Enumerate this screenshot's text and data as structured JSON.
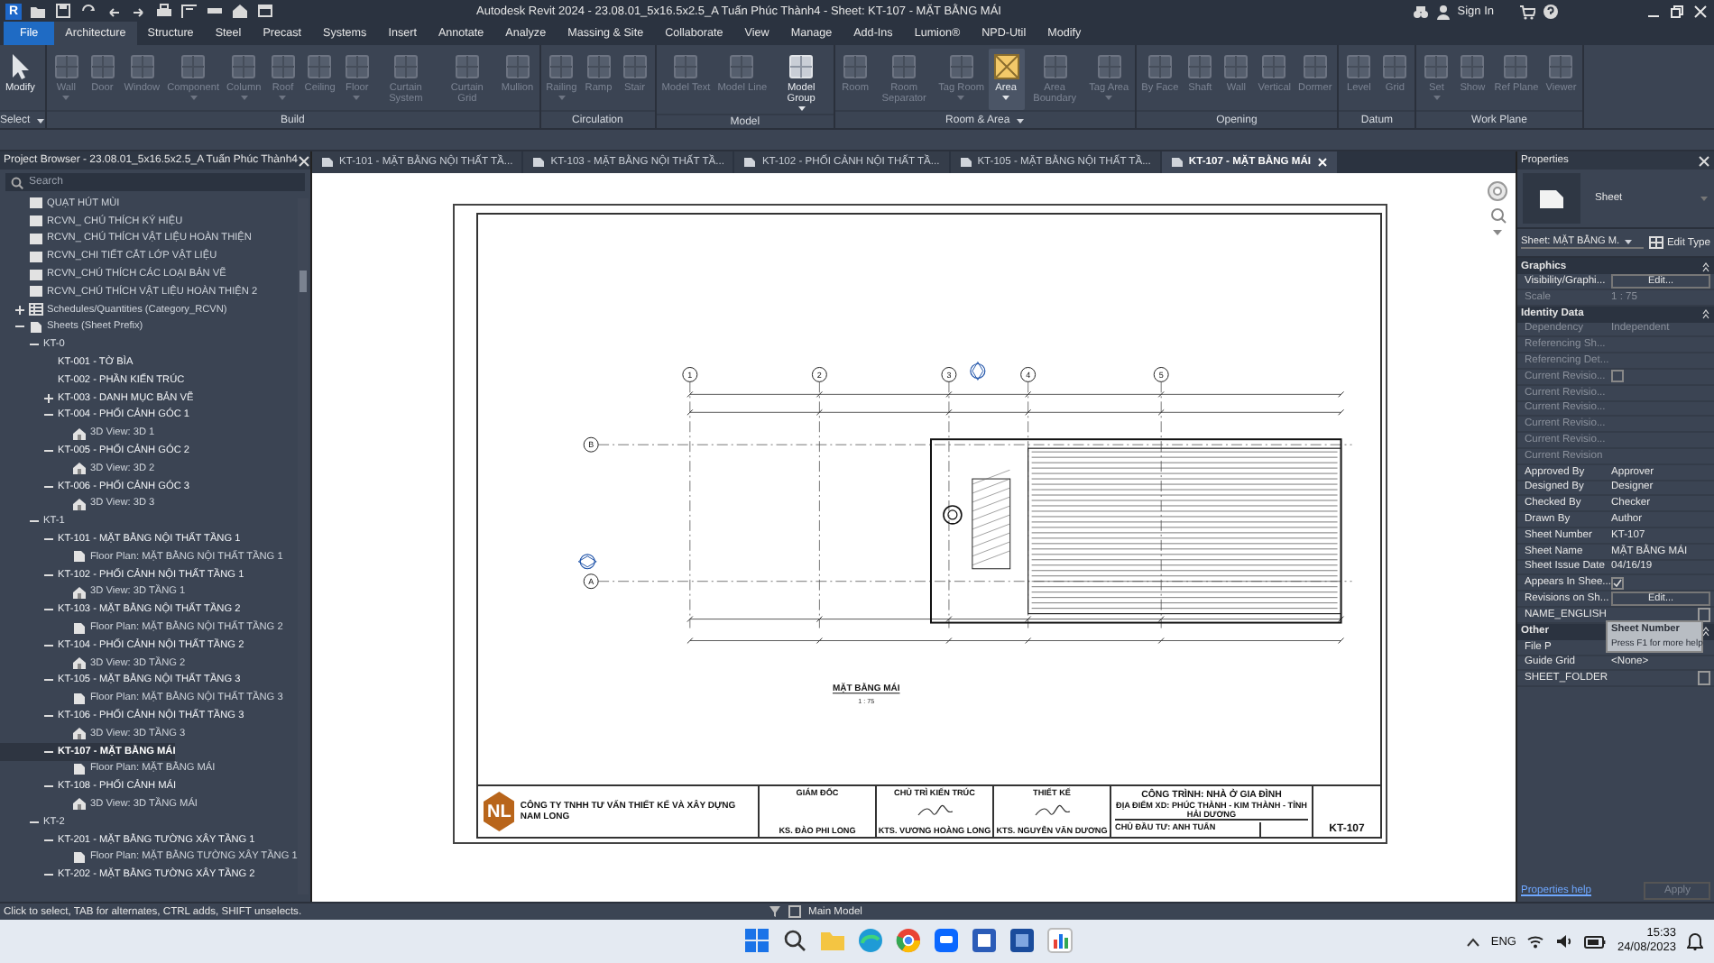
{
  "window": {
    "app_logo": "R",
    "title": "Autodesk Revit 2024 - 23.08.01_5x16.5x2.5_A Tuấn Phúc Thành4 - Sheet: KT-107 - MẶT BẰNG MÁI",
    "sign_in": "Sign In"
  },
  "ribbon_tabs": [
    {
      "label": "File",
      "kind": "file",
      "selected": false
    },
    {
      "label": "Architecture",
      "kind": "tab",
      "selected": true
    },
    {
      "label": "Structure",
      "kind": "tab",
      "selected": false
    },
    {
      "label": "Steel",
      "kind": "tab",
      "selected": false
    },
    {
      "label": "Precast",
      "kind": "tab",
      "selected": false
    },
    {
      "label": "Systems",
      "kind": "tab",
      "selected": false
    },
    {
      "label": "Insert",
      "kind": "tab",
      "selected": false
    },
    {
      "label": "Annotate",
      "kind": "tab",
      "selected": false
    },
    {
      "label": "Analyze",
      "kind": "tab",
      "selected": false
    },
    {
      "label": "Massing & Site",
      "kind": "tab",
      "selected": false
    },
    {
      "label": "Collaborate",
      "kind": "tab",
      "selected": false
    },
    {
      "label": "View",
      "kind": "tab",
      "selected": false
    },
    {
      "label": "Manage",
      "kind": "tab",
      "selected": false
    },
    {
      "label": "Add-Ins",
      "kind": "tab",
      "selected": false
    },
    {
      "label": "Lumion®",
      "kind": "tab",
      "selected": false
    },
    {
      "label": "NPD-Util",
      "kind": "tab",
      "selected": false
    },
    {
      "label": "Modify",
      "kind": "tab",
      "selected": false
    }
  ],
  "ribbon_panels": [
    {
      "title": "Select",
      "has_menu": true,
      "tools": [
        {
          "label": "Modify",
          "disabled": false,
          "selected": false,
          "dropdown": false
        }
      ]
    },
    {
      "title": "Build",
      "has_menu": false,
      "tools": [
        {
          "label": "Wall",
          "disabled": true,
          "selected": false,
          "dropdown": true
        },
        {
          "label": "Door",
          "disabled": true,
          "selected": false,
          "dropdown": false
        },
        {
          "label": "Window",
          "disabled": true,
          "selected": false,
          "dropdown": false
        },
        {
          "label": "Component",
          "disabled": true,
          "selected": false,
          "dropdown": true
        },
        {
          "label": "Column",
          "disabled": true,
          "selected": false,
          "dropdown": true
        },
        {
          "label": "Roof",
          "disabled": true,
          "selected": false,
          "dropdown": true
        },
        {
          "label": "Ceiling",
          "disabled": true,
          "selected": false,
          "dropdown": false
        },
        {
          "label": "Floor",
          "disabled": true,
          "selected": false,
          "dropdown": true
        },
        {
          "label": "Curtain System",
          "disabled": true,
          "selected": false,
          "dropdown": false
        },
        {
          "label": "Curtain Grid",
          "disabled": true,
          "selected": false,
          "dropdown": false
        },
        {
          "label": "Mullion",
          "disabled": true,
          "selected": false,
          "dropdown": false
        }
      ]
    },
    {
      "title": "Circulation",
      "has_menu": false,
      "tools": [
        {
          "label": "Railing",
          "disabled": true,
          "selected": false,
          "dropdown": true
        },
        {
          "label": "Ramp",
          "disabled": true,
          "selected": false,
          "dropdown": false
        },
        {
          "label": "Stair",
          "disabled": true,
          "selected": false,
          "dropdown": false
        }
      ]
    },
    {
      "title": "Model",
      "has_menu": false,
      "tools": [
        {
          "label": "Model Text",
          "disabled": true,
          "selected": false,
          "dropdown": false
        },
        {
          "label": "Model Line",
          "disabled": true,
          "selected": false,
          "dropdown": false
        },
        {
          "label": "Model Group",
          "disabled": false,
          "selected": false,
          "dropdown": true
        }
      ]
    },
    {
      "title": "Room & Area",
      "has_menu": true,
      "tools": [
        {
          "label": "Room",
          "disabled": true,
          "selected": false,
          "dropdown": false
        },
        {
          "label": "Room Separator",
          "disabled": true,
          "selected": false,
          "dropdown": false
        },
        {
          "label": "Tag Room",
          "disabled": true,
          "selected": false,
          "dropdown": true
        },
        {
          "label": "Area",
          "disabled": false,
          "selected": true,
          "dropdown": true
        },
        {
          "label": "Area Boundary",
          "disabled": true,
          "selected": false,
          "dropdown": false
        },
        {
          "label": "Tag Area",
          "disabled": true,
          "selected": false,
          "dropdown": true
        }
      ]
    },
    {
      "title": "Opening",
      "has_menu": false,
      "tools": [
        {
          "label": "By Face",
          "disabled": true,
          "selected": false,
          "dropdown": false
        },
        {
          "label": "Shaft",
          "disabled": true,
          "selected": false,
          "dropdown": false
        },
        {
          "label": "Wall",
          "disabled": true,
          "selected": false,
          "dropdown": false
        },
        {
          "label": "Vertical",
          "disabled": true,
          "selected": false,
          "dropdown": false
        },
        {
          "label": "Dormer",
          "disabled": true,
          "selected": false,
          "dropdown": false
        }
      ]
    },
    {
      "title": "Datum",
      "has_menu": false,
      "tools": [
        {
          "label": "Level",
          "disabled": true,
          "selected": false,
          "dropdown": false
        },
        {
          "label": "Grid",
          "disabled": true,
          "selected": false,
          "dropdown": false
        }
      ]
    },
    {
      "title": "Work Plane",
      "has_menu": false,
      "tools": [
        {
          "label": "Set",
          "disabled": true,
          "selected": false,
          "dropdown": true
        },
        {
          "label": "Show",
          "disabled": true,
          "selected": false,
          "dropdown": false
        },
        {
          "label": "Ref Plane",
          "disabled": true,
          "selected": false,
          "dropdown": false
        },
        {
          "label": "Viewer",
          "disabled": true,
          "selected": false,
          "dropdown": false
        }
      ]
    }
  ],
  "project_browser": {
    "title": "Project Browser - 23.08.01_5x16.5x2.5_A Tuấn Phúc Thành4",
    "search": {
      "placeholder": "Search"
    },
    "tree": [
      {
        "label": "QUẠT HÚT MÙI",
        "kind": "legend",
        "selected": false
      },
      {
        "label": "RCVN_ CHÚ THÍCH KÝ HIỆU",
        "kind": "legend",
        "selected": false
      },
      {
        "label": "RCVN_ CHÚ THÍCH VẬT LIỆU HOÀN THIỆN",
        "kind": "legend",
        "selected": false
      },
      {
        "label": "RCVN_CHI TIẾT CẮT LỚP VẬT LIỆU",
        "kind": "legend",
        "selected": false
      },
      {
        "label": "RCVN_CHÚ THÍCH CÁC LOẠI BẢN VẼ",
        "kind": "legend",
        "selected": false
      },
      {
        "label": "RCVN_CHÚ THÍCH VẬT LIỆU HOÀN THIỆN 2",
        "kind": "legend",
        "selected": false
      },
      {
        "label": "Schedules/Quantities (Category_RCVN)",
        "kind": "schedules",
        "expanded": false,
        "selected": false
      },
      {
        "label": "Sheets (Sheet Prefix)",
        "kind": "sheets",
        "expanded": true,
        "selected": false,
        "children": [
          {
            "label": "KT-0",
            "kind": "group",
            "expanded": true,
            "selected": false,
            "children": [
              {
                "label": "KT-001 - TỜ BÌA",
                "kind": "sheet",
                "selected": false
              },
              {
                "label": "KT-002 - PHẦN KIẾN TRÚC",
                "kind": "sheet",
                "selected": false
              },
              {
                "label": "KT-003 - DANH MỤC BẢN VẼ",
                "kind": "sheet",
                "expanded": false,
                "selected": false
              },
              {
                "label": "KT-004 - PHỐI CẢNH GÓC 1",
                "kind": "sheet",
                "expanded": true,
                "selected": false,
                "children": [
                  {
                    "label": "3D View: 3D 1",
                    "kind": "view3d",
                    "selected": false
                  }
                ]
              },
              {
                "label": "KT-005 - PHỐI CẢNH GÓC 2",
                "kind": "sheet",
                "expanded": true,
                "selected": false,
                "children": [
                  {
                    "label": "3D View: 3D 2",
                    "kind": "view3d",
                    "selected": false
                  }
                ]
              },
              {
                "label": "KT-006 - PHỐI CẢNH GÓC 3",
                "kind": "sheet",
                "expanded": true,
                "selected": false,
                "children": [
                  {
                    "label": "3D View: 3D 3",
                    "kind": "view3d",
                    "selected": false
                  }
                ]
              }
            ]
          },
          {
            "label": "KT-1",
            "kind": "group",
            "expanded": true,
            "selected": false,
            "children": [
              {
                "label": "KT-101 - MẶT BẰNG NỘI THẤT TẦNG 1",
                "kind": "sheet",
                "expanded": true,
                "selected": false,
                "children": [
                  {
                    "label": "Floor Plan: MẶT BẰNG NỘI THẤT TẦNG 1",
                    "kind": "plan",
                    "selected": false
                  }
                ]
              },
              {
                "label": "KT-102 - PHỐI CẢNH NỘI THẤT TẦNG 1",
                "kind": "sheet",
                "expanded": true,
                "selected": false,
                "children": [
                  {
                    "label": "3D View: 3D TẦNG 1",
                    "kind": "view3d",
                    "selected": false
                  }
                ]
              },
              {
                "label": "KT-103 - MẶT BẰNG NỘI THẤT TẦNG 2",
                "kind": "sheet",
                "expanded": true,
                "selected": false,
                "children": [
                  {
                    "label": "Floor Plan: MẶT BẰNG NỘI THẤT TẦNG 2",
                    "kind": "plan",
                    "selected": false
                  }
                ]
              },
              {
                "label": "KT-104 - PHỐI CẢNH NỘI THẤT TẦNG 2",
                "kind": "sheet",
                "expanded": true,
                "selected": false,
                "children": [
                  {
                    "label": "3D View: 3D TẦNG 2",
                    "kind": "view3d",
                    "selected": false
                  }
                ]
              },
              {
                "label": "KT-105 - MẶT BẰNG NỘI THẤT TẦNG 3",
                "kind": "sheet",
                "expanded": true,
                "selected": false,
                "children": [
                  {
                    "label": "Floor Plan: MẶT BẰNG NỘI THẤT TẦNG 3",
                    "kind": "plan",
                    "selected": false
                  }
                ]
              },
              {
                "label": "KT-106 - PHỐI CẢNH NỘI THẤT TẦNG 3",
                "kind": "sheet",
                "expanded": true,
                "selected": false,
                "children": [
                  {
                    "label": "3D View: 3D TẦNG 3",
                    "kind": "view3d",
                    "selected": false
                  }
                ]
              },
              {
                "label": "KT-107 - MẶT BẰNG MÁI",
                "kind": "sheet",
                "expanded": true,
                "selected": true,
                "children": [
                  {
                    "label": "Floor Plan: MẶT BẰNG MÁI",
                    "kind": "plan",
                    "selected": false
                  }
                ]
              },
              {
                "label": "KT-108 - PHỐI CẢNH MÁI",
                "kind": "sheet",
                "expanded": true,
                "selected": false,
                "children": [
                  {
                    "label": "3D View: 3D TẦNG MÁI",
                    "kind": "view3d",
                    "selected": false
                  }
                ]
              }
            ]
          },
          {
            "label": "KT-2",
            "kind": "group",
            "expanded": true,
            "selected": false,
            "children": [
              {
                "label": "KT-201 - MẶT BẰNG TƯỜNG XÂY TẦNG 1",
                "kind": "sheet",
                "expanded": true,
                "selected": false,
                "children": [
                  {
                    "label": "Floor Plan: MẶT BẰNG TƯỜNG XÂY TẦNG 1",
                    "kind": "plan",
                    "selected": false
                  }
                ]
              },
              {
                "label": "KT-202 - MẶT BẰNG TƯỜNG XÂY TẦNG 2",
                "kind": "sheet",
                "expanded": true,
                "selected": false
              }
            ]
          }
        ]
      }
    ]
  },
  "view_tabs": [
    {
      "label": "KT-101 - MẶT BẰNG NỘI THẤT TẦ...",
      "selected": false
    },
    {
      "label": "KT-103 - MẶT BẰNG NỘI THẤT TẦ...",
      "selected": false
    },
    {
      "label": "KT-102 - PHỐI CẢNH NỘI THẤT TẦ...",
      "selected": false
    },
    {
      "label": "KT-105 - MẶT BẰNG NỘI THẤT TẦ...",
      "selected": false
    },
    {
      "label": "KT-107 - MẶT BẰNG MÁI",
      "selected": true
    }
  ],
  "sheet": {
    "plan": {
      "grid_columns": [
        "1",
        "2",
        "3",
        "4",
        "5"
      ],
      "grid_rows": [
        "B",
        "A"
      ],
      "title": "MẶT BẰNG MÁI",
      "scale": "1 : 75"
    },
    "title_block": {
      "logo": "NL",
      "company": "CÔNG TY TNHH TƯ VẤN THIẾT KẾ VÀ XÂY DỰNG NAM LONG",
      "roles": [
        {
          "title": "GIÁM ĐỐC",
          "name": "KS. ĐÀO PHI LONG"
        },
        {
          "title": "CHỦ TRÌ KIẾN TRÚC",
          "name": "KTS. VƯƠNG HOÀNG LONG"
        },
        {
          "title": "THIẾT KẾ",
          "name": "KTS. NGUYỄN VĂN DƯƠNG"
        }
      ],
      "project": "CÔNG TRÌNH: NHÀ Ở GIA ĐÌNH",
      "location": "ĐỊA ĐIỂM XD: PHÚC THÀNH - KIM THÀNH - TỈNH HẢI DƯƠNG",
      "owner": "CHỦ ĐẦU TƯ: ANH TUẤN",
      "sheet_number": "KT-107"
    }
  },
  "properties": {
    "title": "Properties",
    "type_name": "Sheet",
    "instance_selector": "Sheet: MẶT BẰNG M.",
    "edit_type": "Edit Type",
    "groups": [
      {
        "title": "Graphics",
        "rows": [
          {
            "label": "Visibility/Graphi...",
            "kind": "button",
            "value": "Edit...",
            "disabled": false
          },
          {
            "label": "Scale",
            "kind": "text",
            "value": "1 : 75",
            "disabled": true
          }
        ]
      },
      {
        "title": "Identity Data",
        "rows": [
          {
            "label": "Dependency",
            "kind": "text",
            "value": "Independent",
            "disabled": true
          },
          {
            "label": "Referencing Sh...",
            "kind": "text",
            "disabled": true
          },
          {
            "label": "Referencing Det...",
            "kind": "text",
            "disabled": true
          },
          {
            "label": "Current Revisio...",
            "kind": "checkbox",
            "checked": false,
            "disabled": true
          },
          {
            "label": "Current Revisio...",
            "kind": "text",
            "disabled": true
          },
          {
            "label": "Current Revisio...",
            "kind": "text",
            "disabled": true
          },
          {
            "label": "Current Revisio...",
            "kind": "text",
            "disabled": true
          },
          {
            "label": "Current Revisio...",
            "kind": "text",
            "disabled": true
          },
          {
            "label": "Current Revision",
            "kind": "text",
            "disabled": true
          },
          {
            "label": "Approved By",
            "kind": "text",
            "value": "Approver",
            "disabled": false
          },
          {
            "label": "Designed By",
            "kind": "text",
            "value": "Designer",
            "disabled": false
          },
          {
            "label": "Checked By",
            "kind": "text",
            "value": "Checker",
            "disabled": false
          },
          {
            "label": "Drawn By",
            "kind": "text",
            "value": "Author",
            "disabled": false
          },
          {
            "label": "Sheet Number",
            "kind": "text",
            "value": "KT-107",
            "disabled": false
          },
          {
            "label": "Sheet Name",
            "kind": "text",
            "value": "MẶT BẰNG MÁI",
            "disabled": false
          },
          {
            "label": "Sheet Issue Date",
            "kind": "text",
            "value": "04/16/19",
            "disabled": false
          },
          {
            "label": "Appears In Shee...",
            "kind": "checkbox",
            "checked": true,
            "disabled": false
          },
          {
            "label": "Revisions on Sh...",
            "kind": "button",
            "value": "Edit...",
            "disabled": false
          },
          {
            "label": "NAME_ENGLISH",
            "kind": "field",
            "disabled": false
          }
        ]
      },
      {
        "title": "Other",
        "rows": [
          {
            "label": "File P",
            "kind": "text",
            "disabled": false
          },
          {
            "label": "Guide Grid",
            "kind": "text",
            "value": "<None>",
            "disabled": false
          },
          {
            "label": "SHEET_FOLDER",
            "kind": "field",
            "disabled": false
          }
        ]
      }
    ],
    "tooltip": {
      "title": "Sheet Number",
      "hint": "Press F1 for more help"
    },
    "help_link": "Properties help",
    "apply": "Apply",
    "apply_disabled": true
  },
  "status_bar": {
    "hint": "Click to select, TAB for alternates, CTRL adds, SHIFT unselects.",
    "model": "Main Model"
  },
  "taskbar": {
    "language": "ENG",
    "time": "15:33",
    "date": "24/08/2023"
  }
}
